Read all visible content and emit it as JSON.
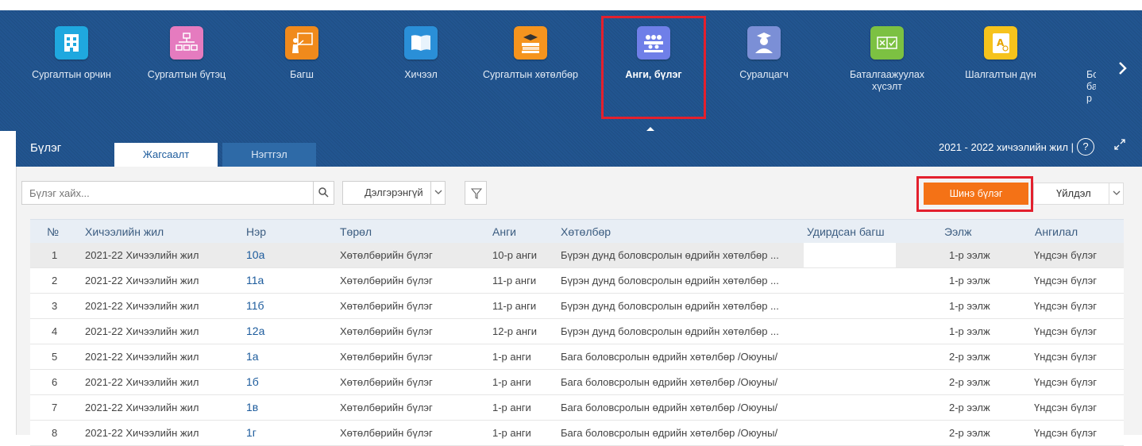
{
  "nav": {
    "items": [
      {
        "label": "Сургалтын орчин",
        "icon": "building-icon",
        "color": "#1fa8df"
      },
      {
        "label": "Сургалтын бүтэц",
        "icon": "org-chart-icon",
        "color": "#e57bbf"
      },
      {
        "label": "Багш",
        "icon": "teacher-board-icon",
        "color": "#f08a1c"
      },
      {
        "label": "Хичээл",
        "icon": "book-icon",
        "color": "#2a8fd8"
      },
      {
        "label": "Сургалтын хөтөлбөр",
        "icon": "books-stack-icon",
        "color": "#f5941e"
      },
      {
        "label": "Анги, бүлэг",
        "icon": "group-icon",
        "color": "#6f7fe8"
      },
      {
        "label": "Суралцагч",
        "icon": "student-icon",
        "color": "#7b8fd6"
      },
      {
        "label": "Баталгаажуулах хүсэлт",
        "icon": "approval-icon",
        "color": "#7cc142"
      },
      {
        "label": "Шалгалтын дүн",
        "icon": "grade-book-icon",
        "color": "#f6c31c"
      },
      {
        "label": "Бог бар",
        "icon": "report-icon",
        "color": "#f59b2d"
      }
    ],
    "next_icon": "chevron-right-icon"
  },
  "panel": {
    "title": "Бүлэг",
    "tabs": [
      "Жагсаалт",
      "Нэгтгэл"
    ],
    "school_year": "2021 - 2022 хичээлийн жил |",
    "help": "?"
  },
  "toolbar": {
    "search_placeholder": "Бүлэг хайх...",
    "detail_select": "Дэлгэрэнгүй",
    "new_button": "Шинэ бүлэг",
    "action_select": "Үйлдэл"
  },
  "table": {
    "columns": [
      "№",
      "Хичээлийн жил",
      "Нэр",
      "Төрөл",
      "Анги",
      "Хөтөлбөр",
      "Удирдсан багш",
      "Ээлж",
      "Ангилал"
    ],
    "rows": [
      {
        "no": "1",
        "year": "2021-22 Хичээлийн жил",
        "name": "10а",
        "type": "Хөтөлбөрийн бүлэг",
        "grade": "10-р анги",
        "program": "Бүрэн дунд боловсролын өдрийн хөтөлбөр ...",
        "teacher": "",
        "shift": "1-р ээлж",
        "category": "Үндсэн бүлэг"
      },
      {
        "no": "2",
        "year": "2021-22 Хичээлийн жил",
        "name": "11а",
        "type": "Хөтөлбөрийн бүлэг",
        "grade": "11-р анги",
        "program": "Бүрэн дунд боловсролын өдрийн хөтөлбөр ...",
        "teacher": "",
        "shift": "1-р ээлж",
        "category": "Үндсэн бүлэг"
      },
      {
        "no": "3",
        "year": "2021-22 Хичээлийн жил",
        "name": "11б",
        "type": "Хөтөлбөрийн бүлэг",
        "grade": "11-р анги",
        "program": "Бүрэн дунд боловсролын өдрийн хөтөлбөр ...",
        "teacher": "",
        "shift": "1-р ээлж",
        "category": "Үндсэн бүлэг"
      },
      {
        "no": "4",
        "year": "2021-22 Хичээлийн жил",
        "name": "12а",
        "type": "Хөтөлбөрийн бүлэг",
        "grade": "12-р анги",
        "program": "Бүрэн дунд боловсролын өдрийн хөтөлбөр ...",
        "teacher": "",
        "shift": "1-р ээлж",
        "category": "Үндсэн бүлэг"
      },
      {
        "no": "5",
        "year": "2021-22 Хичээлийн жил",
        "name": "1а",
        "type": "Хөтөлбөрийн бүлэг",
        "grade": "1-р анги",
        "program": "Бага боловсролын өдрийн хөтөлбөр /Оюуны/",
        "teacher": "",
        "shift": "2-р ээлж",
        "category": "Үндсэн бүлэг"
      },
      {
        "no": "6",
        "year": "2021-22 Хичээлийн жил",
        "name": "1б",
        "type": "Хөтөлбөрийн бүлэг",
        "grade": "1-р анги",
        "program": "Бага боловсролын өдрийн хөтөлбөр /Оюуны/",
        "teacher": "",
        "shift": "2-р ээлж",
        "category": "Үндсэн бүлэг"
      },
      {
        "no": "7",
        "year": "2021-22 Хичээлийн жил",
        "name": "1в",
        "type": "Хөтөлбөрийн бүлэг",
        "grade": "1-р анги",
        "program": "Бага боловсролын өдрийн хөтөлбөр /Оюуны/",
        "teacher": "",
        "shift": "2-р ээлж",
        "category": "Үндсэн бүлэг"
      },
      {
        "no": "8",
        "year": "2021-22 Хичээлийн жил",
        "name": "1г",
        "type": "Хөтөлбөрийн бүлэг",
        "grade": "1-р анги",
        "program": "Бага боловсролын өдрийн хөтөлбөр /Оюуны/",
        "teacher": "",
        "shift": "2-р ээлж",
        "category": "Үндсэн бүлэг"
      }
    ]
  },
  "colors": {
    "nav_bg": "#225590",
    "accent_orange": "#f47216",
    "highlight_red": "#e3202d",
    "link_blue": "#1c5b9c"
  }
}
